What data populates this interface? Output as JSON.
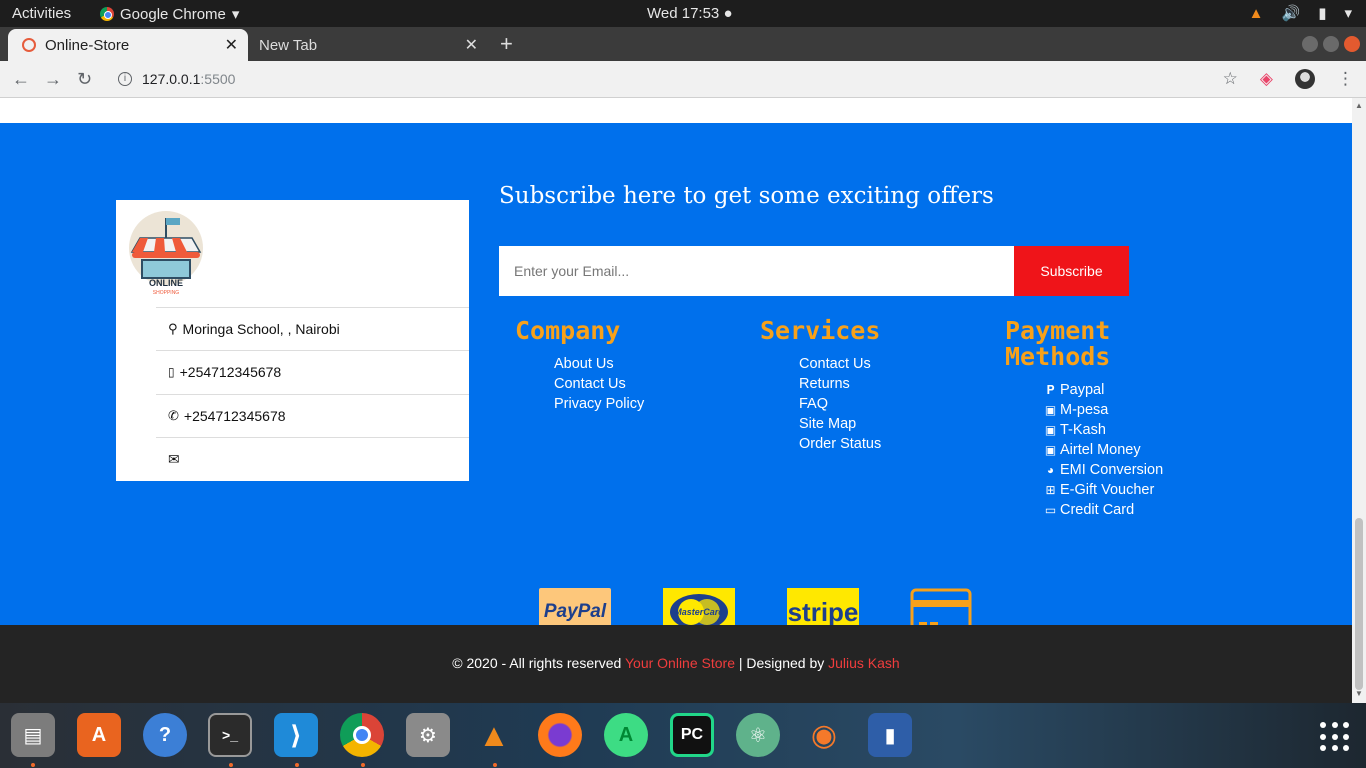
{
  "system": {
    "activities": "Activities",
    "app_name": "Google Chrome",
    "clock": "Wed 17:53"
  },
  "browser": {
    "tabs": [
      {
        "title": "Online-Store",
        "active": true
      },
      {
        "title": "New Tab",
        "active": false
      }
    ],
    "url_host": "127.0.0.1",
    "url_port": ":5500"
  },
  "contact": {
    "logo_text": "ONLINE",
    "logo_subtext": "SHOPPING",
    "address": "Moringa School, , Nairobi",
    "mobile": "+254712345678",
    "phone": "+254712345678",
    "email": ""
  },
  "subscribe": {
    "title": "Subscribe here to get some exciting offers",
    "placeholder": "Enter your Email...",
    "button": "Subscribe"
  },
  "company": {
    "title": "Company",
    "links": [
      "About Us",
      "Contact Us",
      "Privacy Policy"
    ]
  },
  "services": {
    "title": "Services",
    "links": [
      "Contact Us",
      "Returns",
      "FAQ",
      "Site Map",
      "Order Status"
    ]
  },
  "payment": {
    "title_line1": "Payment",
    "title_line2": "Methods",
    "methods": [
      {
        "label": "Paypal",
        "icon": "paypal-icon"
      },
      {
        "label": "M-pesa",
        "icon": "money-icon"
      },
      {
        "label": "T-Kash",
        "icon": "money-icon"
      },
      {
        "label": "Airtel Money",
        "icon": "money-icon"
      },
      {
        "label": "EMI Conversion",
        "icon": "pie-chart-icon"
      },
      {
        "label": "E-Gift Voucher",
        "icon": "gift-icon"
      },
      {
        "label": "Credit Card",
        "icon": "credit-card-icon"
      }
    ]
  },
  "badges": {
    "paypal": "PayPal",
    "mastercard": "MasterCard",
    "stripe": "stripe"
  },
  "copyright": {
    "prefix": "© 2020 - All rights reserved ",
    "store": "Your Online Store",
    "middle": " | Designed by ",
    "author": "Julius Kash"
  },
  "colors": {
    "footer_blue": "#0070ec",
    "accent_orange": "#f7a11a",
    "subscribe_red": "#ef1419",
    "dark_footer": "#242424"
  }
}
